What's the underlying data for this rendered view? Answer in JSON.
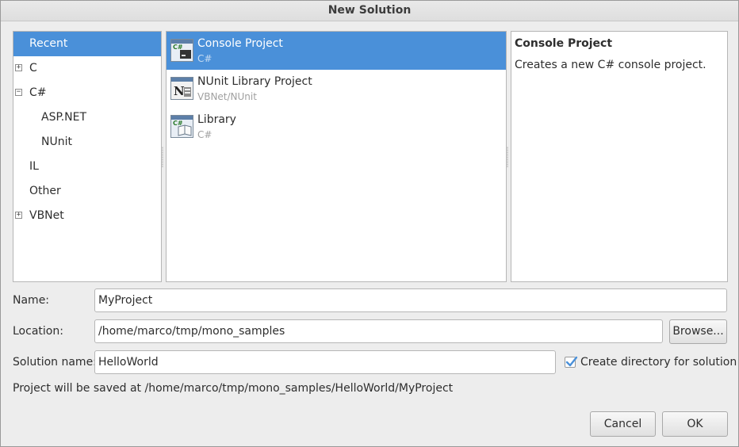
{
  "window": {
    "title": "New Solution"
  },
  "categories": [
    {
      "label": "Recent",
      "expander": "",
      "selected": true
    },
    {
      "label": "C",
      "expander": "+",
      "selected": false
    },
    {
      "label": "C#",
      "expander": "−",
      "selected": false
    },
    {
      "label": "ASP.NET",
      "expander": "",
      "selected": false
    },
    {
      "label": "NUnit",
      "expander": "",
      "selected": false
    },
    {
      "label": "IL",
      "expander": "",
      "selected": false
    },
    {
      "label": "Other",
      "expander": "",
      "selected": false
    },
    {
      "label": "VBNet",
      "expander": "+",
      "selected": false
    }
  ],
  "templates": [
    {
      "name": "Console Project",
      "language": "C#",
      "icon": "console-project-icon",
      "badge": "C#",
      "selected": true
    },
    {
      "name": "NUnit Library Project",
      "language": "VBNet/NUnit",
      "icon": "nunit-library-icon",
      "badge": "N",
      "selected": false
    },
    {
      "name": "Library",
      "language": "C#",
      "icon": "library-icon",
      "badge": "C#",
      "selected": false
    }
  ],
  "description": {
    "title": "Console Project",
    "text": "Creates a new C# console project."
  },
  "form": {
    "name_label": "Name:",
    "name_value": "MyProject",
    "location_label": "Location:",
    "location_value": "/home/marco/tmp/mono_samples",
    "browse_label": "Browse...",
    "solution_label": "Solution name:",
    "solution_value": "HelloWorld",
    "create_dir_label": "Create directory for solution",
    "create_dir_checked": true,
    "save_info": "Project will be saved at /home/marco/tmp/mono_samples/HelloWorld/MyProject"
  },
  "buttons": {
    "cancel": "Cancel",
    "ok": "OK"
  },
  "colors": {
    "selection": "#4a90d9",
    "background": "#ededed"
  }
}
